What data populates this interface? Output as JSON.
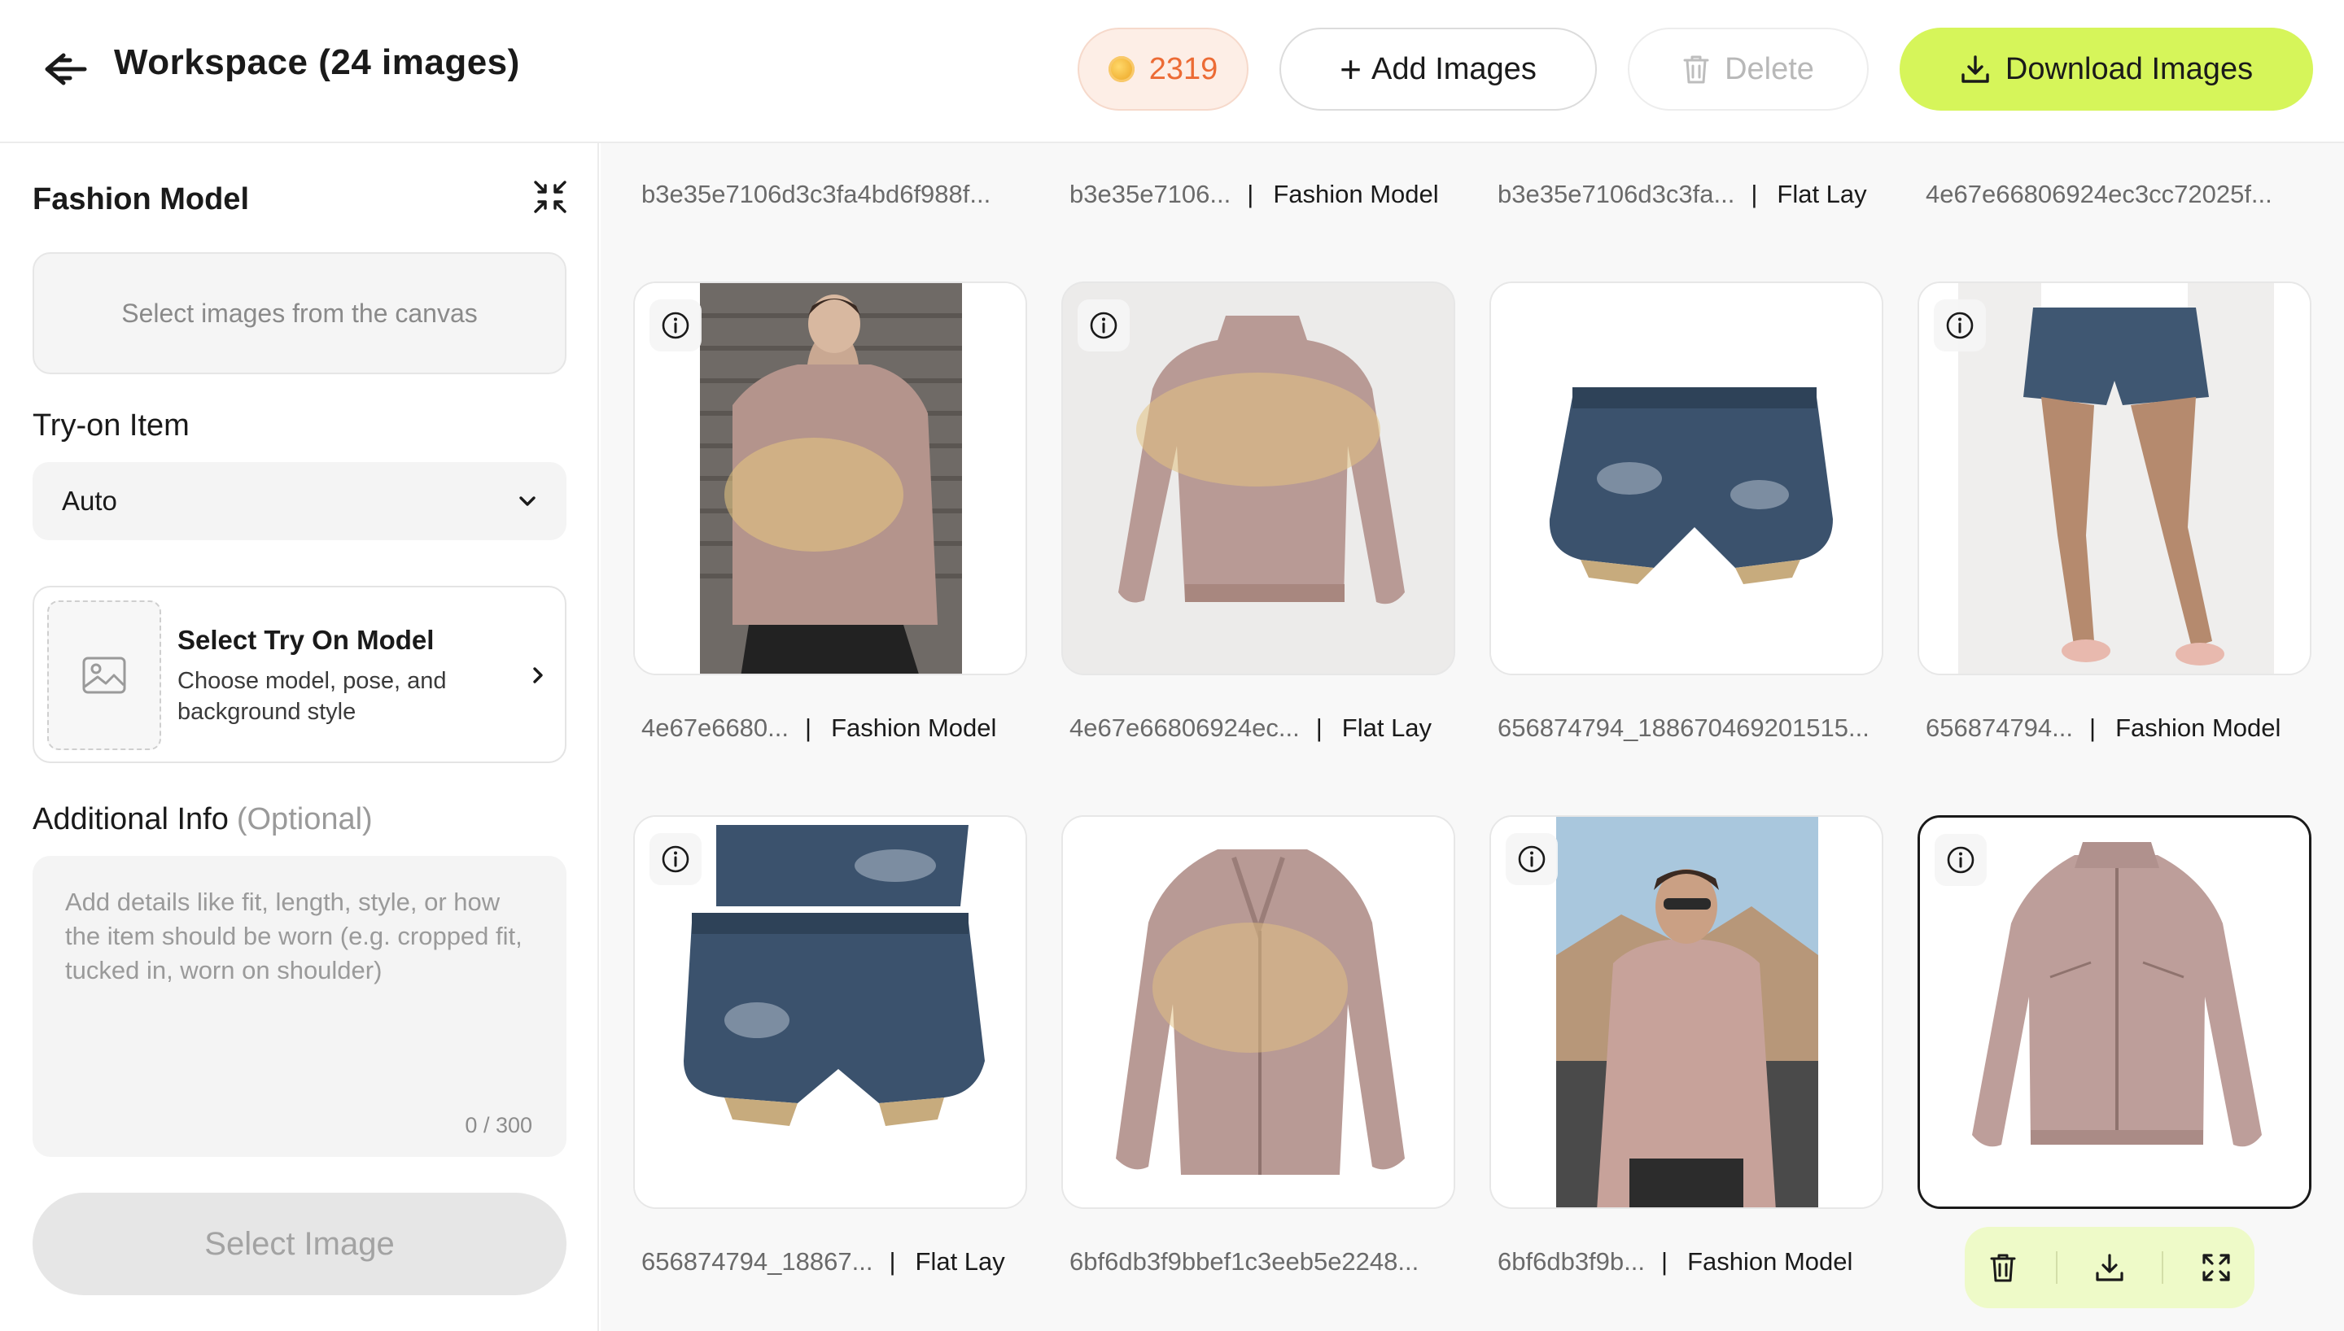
{
  "header": {
    "title": "Workspace (24 images)",
    "credits": "2319",
    "add_label": "Add Images",
    "delete_label": "Delete",
    "download_label": "Download Images"
  },
  "sidebar": {
    "panel_title": "Fashion Model",
    "select_prompt": "Select images from the canvas",
    "tryon_label": "Try-on Item",
    "tryon_value": "Auto",
    "model_card": {
      "title": "Select Try On Model",
      "description": "Choose model, pose, and background style"
    },
    "additional_label": "Additional Info",
    "additional_optional": "(Optional)",
    "additional_placeholder": "Add details like fit, length, style, or how the item should be worn (e.g. cropped fit, tucked in, worn on shoulder)",
    "counter": "0 / 300",
    "select_image_label": "Select Image"
  },
  "grid": {
    "top_captions": [
      {
        "name": "b3e35e7106d3c3fa4bd6f988f...",
        "tag": ""
      },
      {
        "name": "b3e35e7106...",
        "tag": "Fashion Model"
      },
      {
        "name": "b3e35e7106d3c3fa...",
        "tag": "Flat Lay"
      },
      {
        "name": "4e67e66806924ec3cc72025f...",
        "tag": ""
      }
    ],
    "row1": [
      {
        "name": "4e67e6680...",
        "tag": "Fashion Model",
        "subject": "man-back-pink-jacket"
      },
      {
        "name": "4e67e66806924ec...",
        "tag": "Flat Lay",
        "subject": "pink-jacket-back-flatlay"
      },
      {
        "name": "656874794_188670469201515...",
        "tag": "",
        "subject": "denim-shorts"
      },
      {
        "name": "656874794...",
        "tag": "Fashion Model",
        "subject": "model-denim-shorts"
      }
    ],
    "row2": [
      {
        "name": "656874794_18867...",
        "tag": "Flat Lay",
        "subject": "two-denim-shorts"
      },
      {
        "name": "6bf6db3f9bbef1c3eeb5e2248...",
        "tag": "",
        "subject": "pink-jacket-open"
      },
      {
        "name": "6bf6db3f9b...",
        "tag": "Fashion Model",
        "subject": "man-pink-jacket-front"
      },
      {
        "name": "",
        "tag": "",
        "subject": "pink-jacket-front-product"
      }
    ]
  },
  "colors": {
    "accent": "#d6f55a",
    "credits_text": "#ec6b35",
    "jacket": "#b89a95",
    "denim": "#3b526d"
  },
  "icons": [
    "back-arrow-icon",
    "coin-icon",
    "plus-icon",
    "trash-icon",
    "download-icon",
    "collapse-icon",
    "chevron-down-icon",
    "image-placeholder-icon",
    "chevron-right-icon",
    "info-icon",
    "expand-icon"
  ]
}
